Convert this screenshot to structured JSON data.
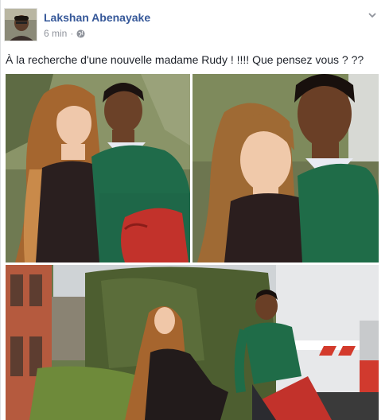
{
  "post": {
    "author": "Lakshan Abenayake",
    "time": "6 min",
    "separator": "·",
    "privacy_icon": "globe-icon",
    "options_icon": "chevron-down-icon",
    "text": "À la recherche d'une nouvelle madame Rudy ! !!!! Que pensez vous ? ??"
  },
  "photos": [
    {
      "name": "photo-1"
    },
    {
      "name": "photo-2"
    },
    {
      "name": "photo-3"
    }
  ],
  "colors": {
    "author_link": "#365899",
    "meta_gray": "#90949c",
    "text": "#1d2129"
  }
}
